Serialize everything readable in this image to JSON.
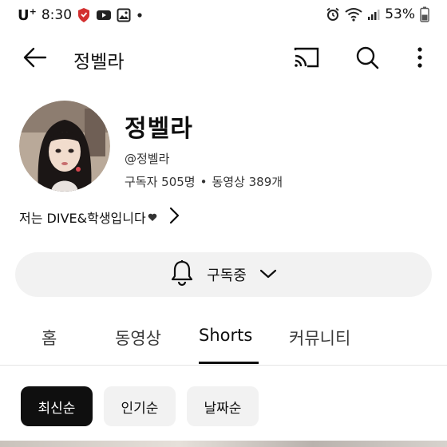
{
  "status_bar": {
    "carrier": "U",
    "carrier_sup": "+",
    "time": "8:30",
    "battery": "53%"
  },
  "app_bar": {
    "title": "정벨라"
  },
  "channel": {
    "name": "정벨라",
    "handle": "@정벨라",
    "subscribers": "구독자 505명",
    "separator": "•",
    "videos": "동영상 389개",
    "description": "저는 DIVE&학생입니다"
  },
  "subscribe": {
    "label": "구독중"
  },
  "tabs": [
    {
      "label": "홈"
    },
    {
      "label": "동영상"
    },
    {
      "label": "Shorts"
    },
    {
      "label": "커뮤니티"
    }
  ],
  "active_tab": "Shorts",
  "chips": [
    {
      "label": "최신순"
    },
    {
      "label": "인기순"
    },
    {
      "label": "날짜순"
    }
  ],
  "selected_chip": "최신순",
  "icons": {
    "status": [
      "shield-icon",
      "youtube-icon",
      "gallery-icon",
      "dot-icon",
      "alarm-icon",
      "wifi-icon",
      "signal-icon",
      "battery-icon"
    ],
    "app_bar": [
      "back-arrow-icon",
      "cast-icon",
      "search-icon",
      "more-vertical-icon"
    ],
    "description": "chevron-right-icon",
    "subscribe": [
      "bell-icon",
      "chevron-down-icon"
    ]
  },
  "colors": {
    "primary_text": "#0f0f0f",
    "chip_selected_bg": "#0f0f0f",
    "chip_bg": "#f2f2f2",
    "shield_red": "#d32f2f"
  }
}
